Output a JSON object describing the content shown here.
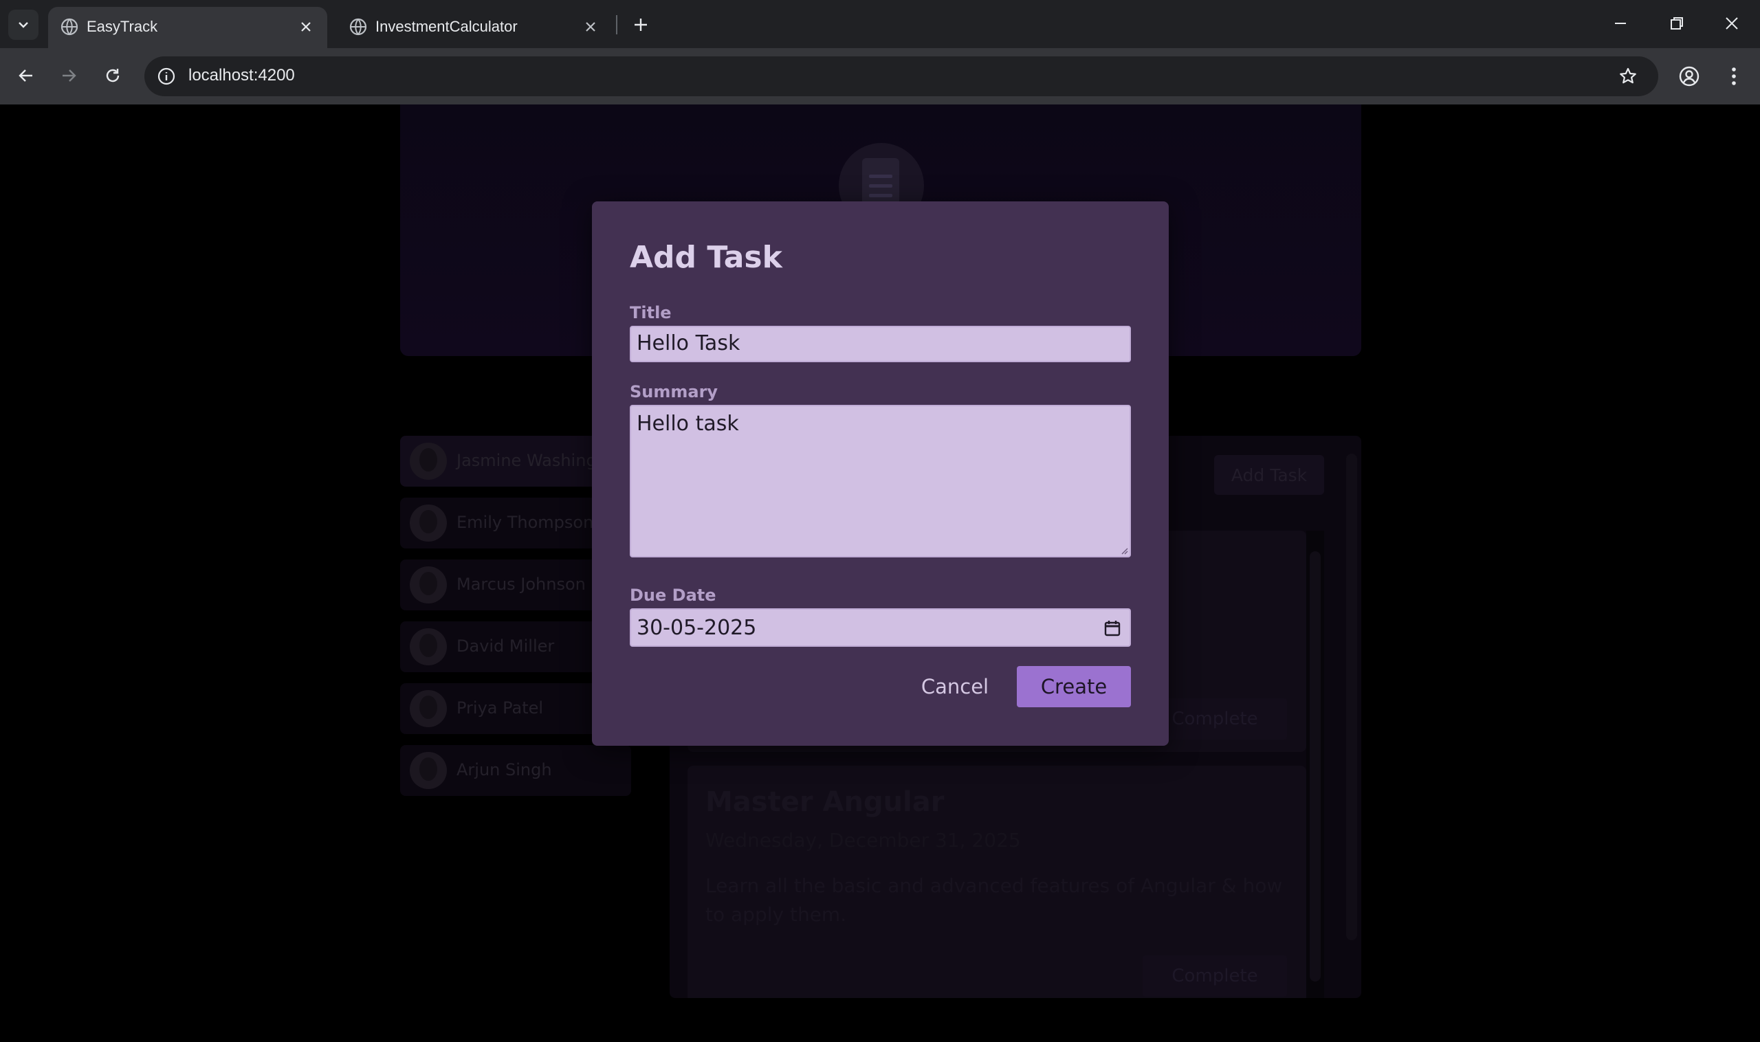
{
  "browser": {
    "tabs": [
      {
        "title": "EasyTrack",
        "active": true
      },
      {
        "title": "InvestmentCalculator",
        "active": false
      }
    ],
    "url": "localhost:4200"
  },
  "users": [
    {
      "name": "Jasmine Washington",
      "selected": true
    },
    {
      "name": "Emily Thompson"
    },
    {
      "name": "Marcus Johnson"
    },
    {
      "name": "David Miller"
    },
    {
      "name": "Priya Patel"
    },
    {
      "name": "Arjun Singh"
    }
  ],
  "tasks_panel": {
    "add_task_label": "Add Task",
    "tasks": [
      {
        "title": "",
        "date": "",
        "summary": "",
        "complete_label": "Complete"
      },
      {
        "title": "Master Angular",
        "date": "Wednesday, December 31, 2025",
        "summary": "Learn all the basic and advanced features of Angular & how to apply them.",
        "complete_label": "Complete"
      }
    ]
  },
  "modal": {
    "title": "Add Task",
    "title_label": "Title",
    "title_value": "Hello Task",
    "summary_label": "Summary",
    "summary_value": "Hello task",
    "due_date_label": "Due Date",
    "due_date_value": "30-05-2025",
    "cancel_label": "Cancel",
    "create_label": "Create"
  },
  "colors": {
    "modal_bg": "#433152",
    "input_bg": "#d1c0e3",
    "accent": "#9b72d0",
    "label": "#b39fc8"
  }
}
